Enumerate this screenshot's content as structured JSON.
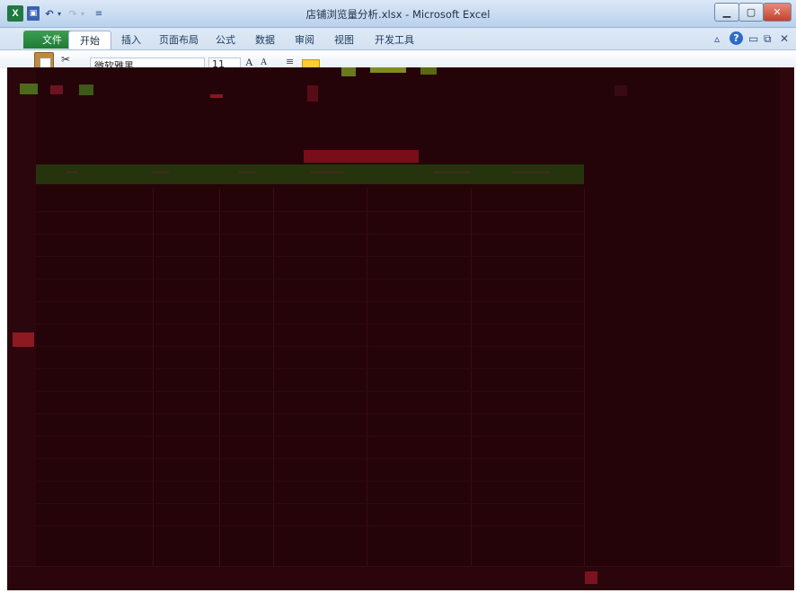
{
  "window": {
    "title": "店铺浏览量分析.xlsx - Microsoft Excel",
    "excel_icon": "X"
  },
  "quick_access": {
    "save_icon": "save-icon",
    "undo_icon": "undo-icon",
    "redo_icon": "redo-icon",
    "customize_icon": "customize-icon"
  },
  "ribbon": {
    "tabs": [
      {
        "label": "文件"
      },
      {
        "label": "开始"
      },
      {
        "label": "插入"
      },
      {
        "label": "页面布局"
      },
      {
        "label": "公式"
      },
      {
        "label": "数据"
      },
      {
        "label": "审阅"
      },
      {
        "label": "视图"
      },
      {
        "label": "开发工具"
      }
    ],
    "active_tab": "开始",
    "font_name": "微软雅黑",
    "font_size": "11",
    "grow_font": "A",
    "shrink_font": "A"
  },
  "colors": {
    "file_tab": "#207a36",
    "content_bg": "#240409",
    "header_band": "#25340c"
  }
}
